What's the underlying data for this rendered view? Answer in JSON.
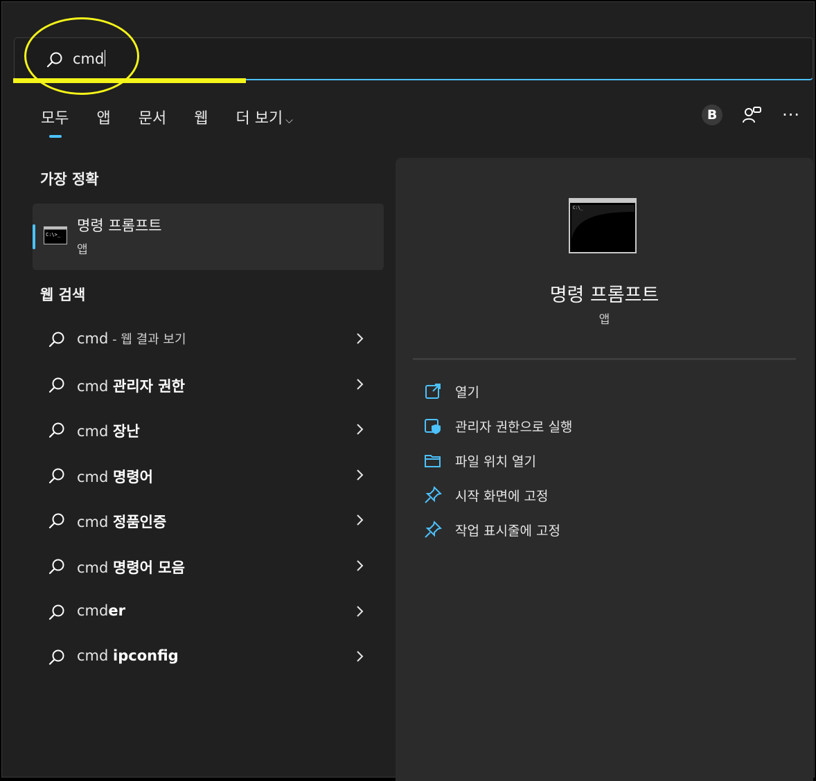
{
  "search": {
    "query": "cmd"
  },
  "tabs": [
    {
      "label": "모두"
    },
    {
      "label": "앱"
    },
    {
      "label": "문서"
    },
    {
      "label": "웹"
    },
    {
      "label": "더 보기"
    }
  ],
  "header": {
    "account_initial": "B"
  },
  "best_match": {
    "title": "가장 정확",
    "name": "명령 프롬프트",
    "type": "앱"
  },
  "web_search": {
    "title": "웹 검색",
    "items": [
      {
        "prefix": "cmd",
        "bold": "",
        "suffix": " - 웹 결과 보기"
      },
      {
        "prefix": "cmd ",
        "bold": "관리자 권한",
        "suffix": ""
      },
      {
        "prefix": "cmd ",
        "bold": "장난",
        "suffix": ""
      },
      {
        "prefix": "cmd ",
        "bold": "명령어",
        "suffix": ""
      },
      {
        "prefix": "cmd ",
        "bold": "정품인증",
        "suffix": ""
      },
      {
        "prefix": "cmd ",
        "bold": "명령어 모음",
        "suffix": ""
      },
      {
        "prefix": "cmd",
        "bold": "er",
        "suffix": ""
      },
      {
        "prefix": "cmd ",
        "bold": "ipconfig",
        "suffix": ""
      }
    ]
  },
  "details": {
    "name": "명령 프롬프트",
    "type": "앱",
    "actions": [
      {
        "label": "열기",
        "icon": "open-external-icon"
      },
      {
        "label": "관리자 권한으로 실행",
        "icon": "admin-shield-icon"
      },
      {
        "label": "파일 위치 열기",
        "icon": "folder-icon"
      },
      {
        "label": "시작 화면에 고정",
        "icon": "pin-icon"
      },
      {
        "label": "작업 표시줄에 고정",
        "icon": "pin-icon"
      }
    ]
  },
  "colors": {
    "accent": "#4cc2ff",
    "highlight": "#f5f51a",
    "background": "#202020",
    "panel": "#2b2b2b"
  }
}
